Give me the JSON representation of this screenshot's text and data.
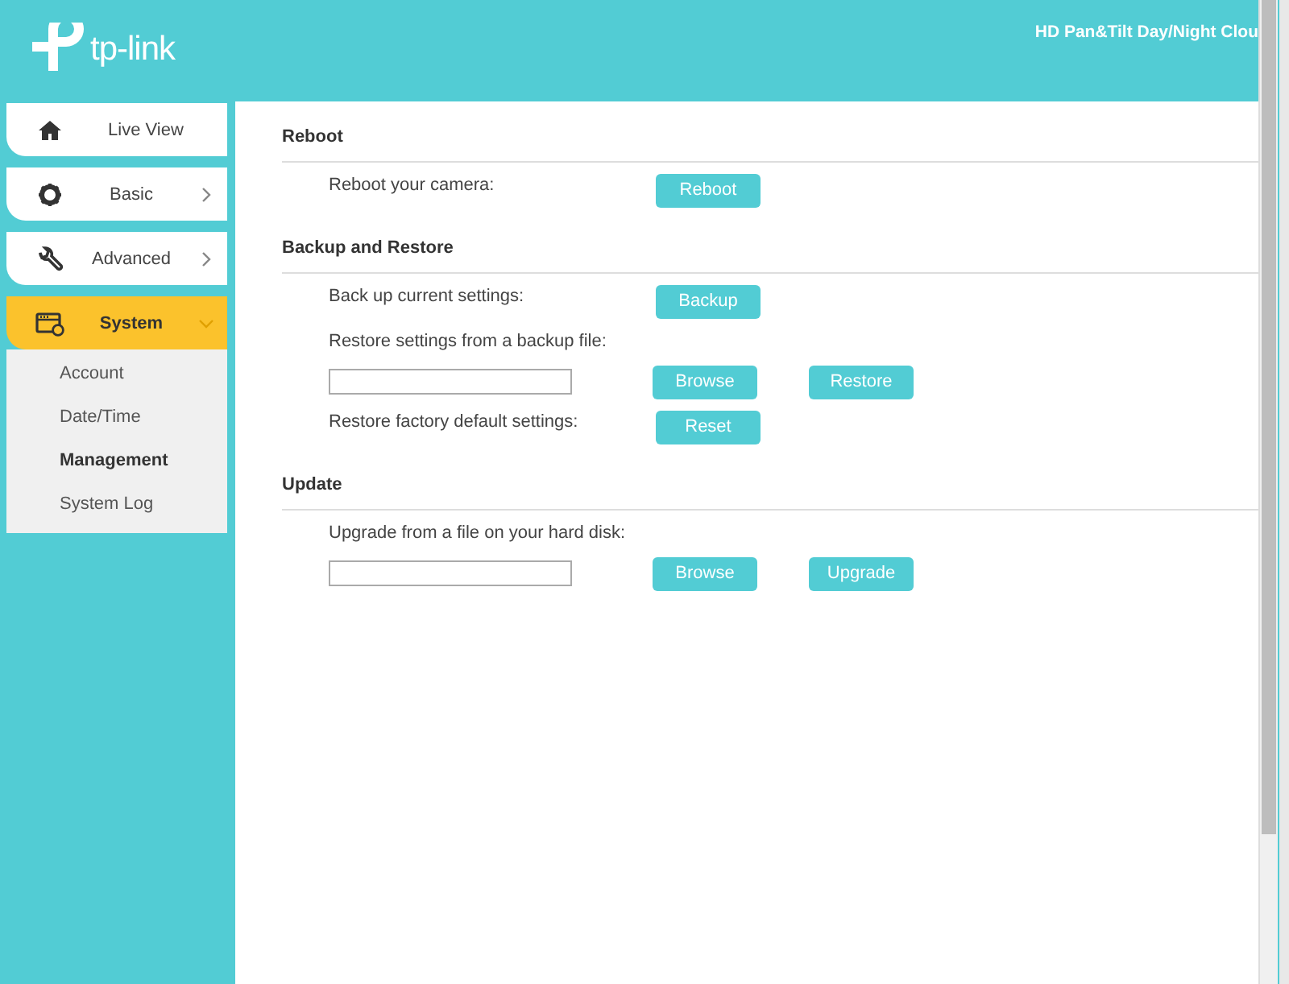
{
  "header": {
    "brand": "tp-link",
    "title": "HD Pan&Tilt Day/Night Clou"
  },
  "nav": [
    {
      "label": "Live View",
      "selected": false
    },
    {
      "label": "Basic",
      "expanded": false,
      "selected": false
    },
    {
      "label": "Advanced",
      "expanded": false,
      "selected": false
    },
    {
      "label": "System",
      "expanded": true,
      "selected": true,
      "children": [
        {
          "label": "Account",
          "selected": false
        },
        {
          "label": "Date/Time",
          "selected": false
        },
        {
          "label": "Management",
          "selected": true
        },
        {
          "label": "System Log",
          "selected": false
        }
      ]
    }
  ],
  "sections": [
    {
      "title": "Reboot",
      "rows": [
        {
          "kind": "inline",
          "label": "Reboot your camera:",
          "buttons": [
            "Reboot"
          ]
        }
      ]
    },
    {
      "title": "Backup and Restore",
      "rows": [
        {
          "kind": "inline",
          "label": "Back up current settings:",
          "buttons": [
            "Backup"
          ]
        },
        {
          "kind": "file",
          "label": "Restore settings from a backup file:",
          "buttons": [
            "Browse",
            "Restore"
          ]
        },
        {
          "kind": "inline",
          "label": "Restore factory default settings:",
          "buttons": [
            "Reset"
          ]
        }
      ]
    },
    {
      "title": "Update",
      "rows": [
        {
          "kind": "file",
          "label": "Upgrade from a file on your hard disk:",
          "buttons": [
            "Browse",
            "Upgrade"
          ]
        }
      ]
    }
  ]
}
